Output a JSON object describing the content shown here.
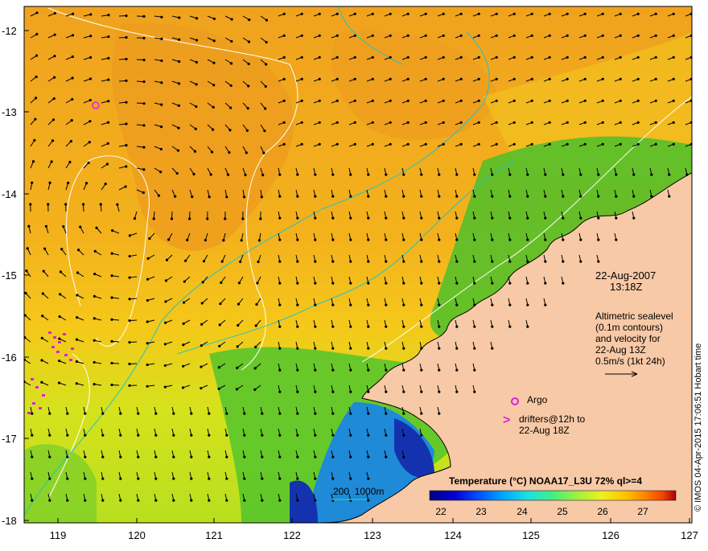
{
  "map": {
    "lat_labels": [
      "-12",
      "-13",
      "-14",
      "-15",
      "-16",
      "-17",
      "-18"
    ],
    "lon_labels": [
      "119",
      "120",
      "121",
      "122",
      "123",
      "124",
      "125",
      "126",
      "127"
    ],
    "colors": {
      "ocean_warm": "#f0a21e",
      "ocean_mid": "#f5c81a",
      "ocean_cool": "#a8dc1e",
      "ocean_green": "#3fbf2a",
      "ocean_cold": "#1632b4",
      "land": "#f8c9a6",
      "contour": "#ffffff",
      "isobath": "#22c4c4",
      "marker": "#e01ee0"
    }
  },
  "annotations": {
    "date": "22-Aug-2007",
    "time": "13:18Z",
    "altimetry_lines": [
      "Altimetric sealevel",
      "(0.1m contours)",
      "and velocity for",
      "22-Aug 13Z",
      "0.5m/s (1kt 24h)"
    ],
    "argo_label": "Argo",
    "drifters_symbol": ">",
    "drifters_lines": [
      "drifters@12h to",
      "22-Aug 18Z"
    ],
    "isobath_label": "200  1000m"
  },
  "colorbar": {
    "title": "Temperature (°C) NOAA17_L3U 72% ql>=4",
    "ticks": [
      "22",
      "23",
      "24",
      "25",
      "26",
      "27"
    ],
    "colors": [
      "#000080",
      "#0000d0",
      "#0050ff",
      "#00a8ff",
      "#20e0e0",
      "#40f080",
      "#a0f040",
      "#f0f020",
      "#ffc000",
      "#ff8000",
      "#f04000",
      "#b00000"
    ]
  },
  "credit": "© IMOS 04-Apr-2015 17:06:51 Hobart time"
}
